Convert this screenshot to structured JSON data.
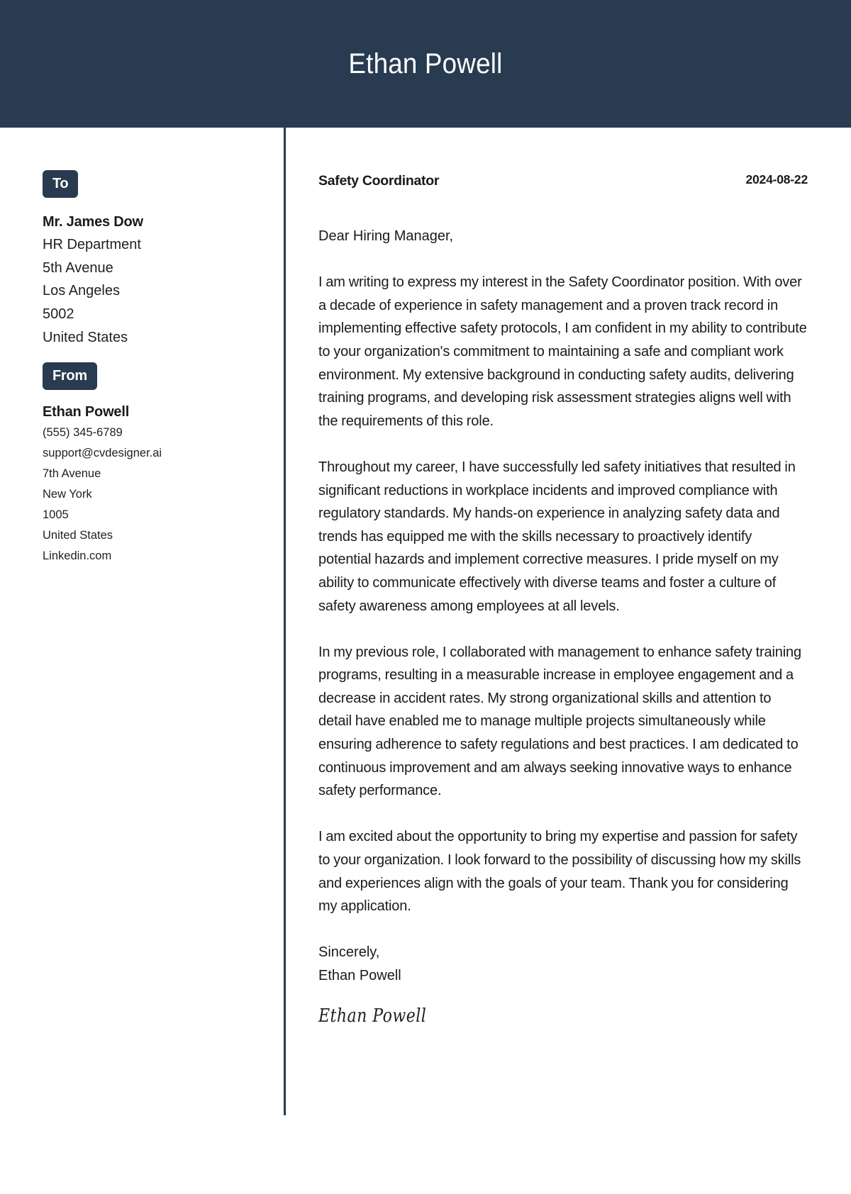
{
  "header": {
    "name": "Ethan Powell"
  },
  "theme": {
    "accent": "#283b50"
  },
  "recipient": {
    "badge_label": "To",
    "name": "Mr. James Dow",
    "lines": [
      "HR Department",
      "5th Avenue",
      "Los Angeles",
      "5002",
      "United States"
    ]
  },
  "sender": {
    "badge_label": "From",
    "name": "Ethan Powell",
    "lines": [
      "(555) 345-6789",
      "support@cvdesigner.ai",
      "7th Avenue",
      "New York",
      "1005",
      "United States",
      "Linkedin.com"
    ]
  },
  "letter": {
    "subject": "Safety Coordinator",
    "date": "2024-08-22",
    "greeting": "Dear Hiring Manager,",
    "paragraphs": [
      "I am writing to express my interest in the Safety Coordinator position. With over a decade of experience in safety management and a proven track record in implementing effective safety protocols, I am confident in my ability to contribute to your organization's commitment to maintaining a safe and compliant work environment. My extensive background in conducting safety audits, delivering training programs, and developing risk assessment strategies aligns well with the requirements of this role.",
      "Throughout my career, I have successfully led safety initiatives that resulted in significant reductions in workplace incidents and improved compliance with regulatory standards. My hands-on experience in analyzing safety data and trends has equipped me with the skills necessary to proactively identify potential hazards and implement corrective measures. I pride myself on my ability to communicate effectively with diverse teams and foster a culture of safety awareness among employees at all levels.",
      "In my previous role, I collaborated with management to enhance safety training programs, resulting in a measurable increase in employee engagement and a decrease in accident rates. My strong organizational skills and attention to detail have enabled me to manage multiple projects simultaneously while ensuring adherence to safety regulations and best practices. I am dedicated to continuous improvement and am always seeking innovative ways to enhance safety performance.",
      "I am excited about the opportunity to bring my expertise and passion for safety to your organization. I look forward to the possibility of discussing how my skills and experiences align with the goals of your team. Thank you for considering my application."
    ],
    "closing": "Sincerely,",
    "closing_name": "Ethan Powell",
    "signature": "Ethan Powell"
  }
}
